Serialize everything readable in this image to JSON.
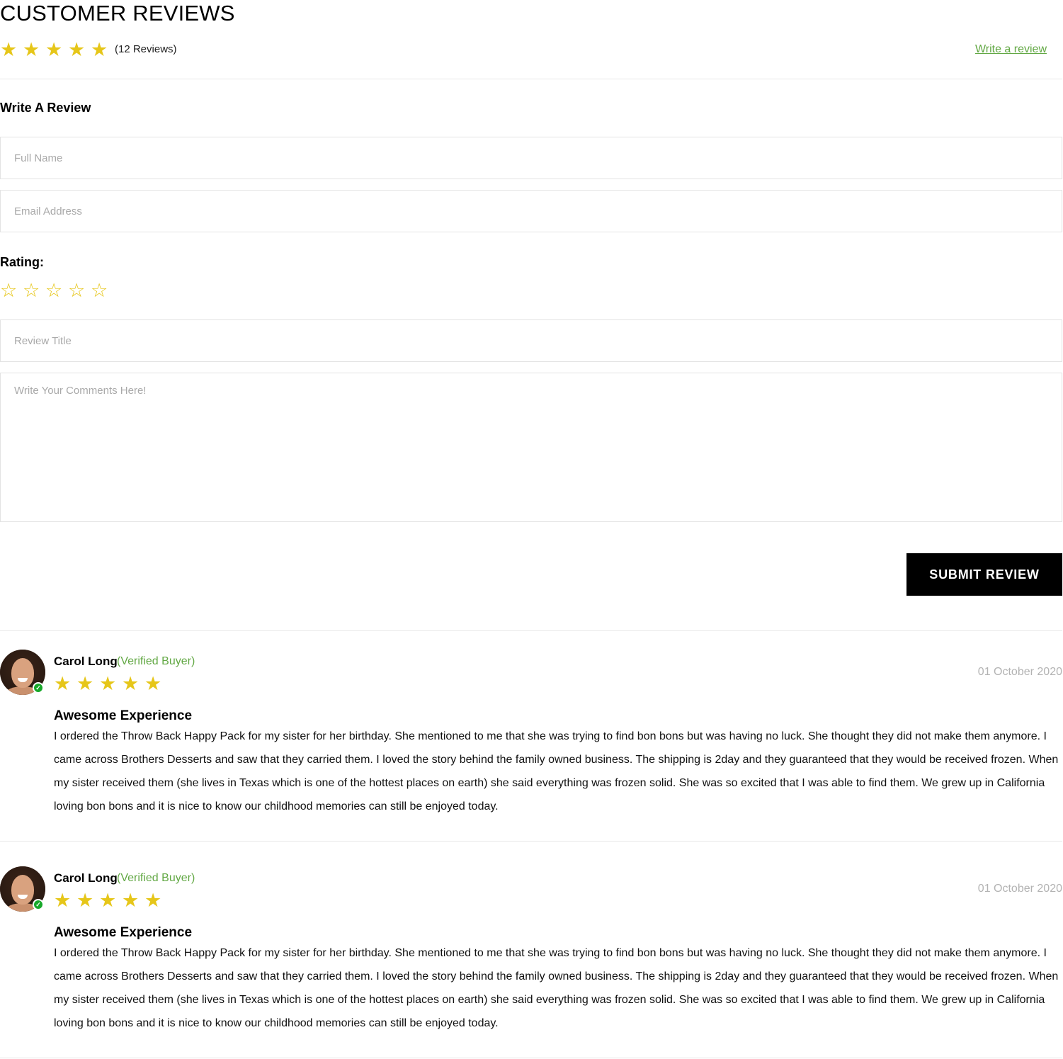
{
  "header": {
    "title": "CUSTOMER REVIEWS",
    "summary_rating": 5,
    "review_count": "(12 Reviews)",
    "write_link": "Write a review"
  },
  "form": {
    "heading": "Write A Review",
    "full_name_placeholder": "Full Name",
    "email_placeholder": "Email Address",
    "rating_label": "Rating:",
    "rating_value": 0,
    "title_placeholder": "Review Title",
    "comments_placeholder": "Write Your Comments Here!",
    "submit_label": "SUBMIT REVIEW"
  },
  "icons": {
    "star_filled": "star-icon",
    "star_outline": "star-outline-icon",
    "verified": "check-circle-icon"
  },
  "colors": {
    "star": "#e6c619",
    "accent_green": "#62a844",
    "verified_badge": "#17a82a",
    "button_bg": "#000000"
  },
  "reviews": [
    {
      "name": "Carol Long",
      "verified": "(Verified Buyer)",
      "rating": 5,
      "date": "01 October 2020",
      "title": "Awesome Experience",
      "body": "I ordered the Throw Back Happy Pack for my sister for her birthday. She mentioned to me that she was trying to find bon bons but was having no luck. She thought they did not make them anymore. I came across Brothers Desserts and saw that they carried them. I loved the story behind the family owned business. The shipping is 2day and they guaranteed that they would be received frozen. When my sister received them (she lives in Texas which is one of the hottest places on earth) she said everything was frozen solid. She was so excited that I was able to find them. We grew up in California loving bon bons and it is nice to know our childhood memories can still be enjoyed today."
    },
    {
      "name": "Carol Long",
      "verified": "(Verified Buyer)",
      "rating": 5,
      "date": "01 October 2020",
      "title": "Awesome Experience",
      "body": "I ordered the Throw Back Happy Pack for my sister for her birthday. She mentioned to me that she was trying to find bon bons but was having no luck. She thought they did not make them anymore. I came across Brothers Desserts and saw that they carried them. I loved the story behind the family owned business. The shipping is 2day and they guaranteed that they would be received frozen. When my sister received them (she lives in Texas which is one of the hottest places on earth) she said everything was frozen solid. She was so excited that I was able to find them. We grew up in California loving bon bons and it is nice to know our childhood memories can still be enjoyed today."
    }
  ]
}
